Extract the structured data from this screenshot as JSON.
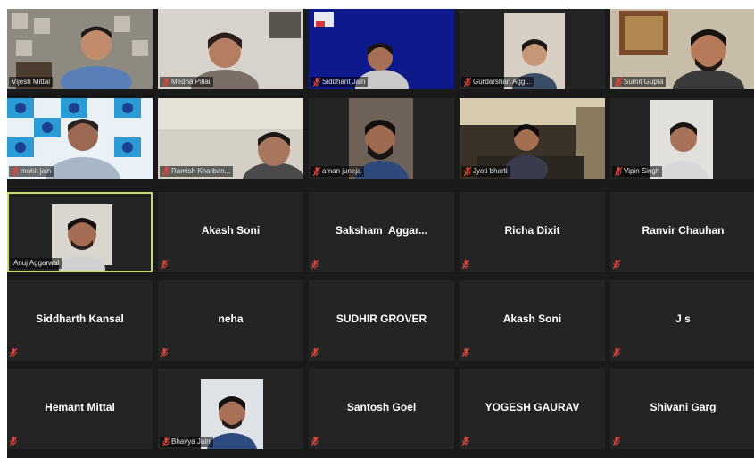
{
  "colors": {
    "background": "#1a1a1a",
    "tile": "#242424",
    "active_border": "#c9dc68",
    "mute_icon": "#e0453a"
  },
  "participants": [
    {
      "name": "Vijesh Mittal",
      "video": true
    },
    {
      "name": "Medha Pillai",
      "video": true
    },
    {
      "name": "Siddhant Jain",
      "video": true
    },
    {
      "name": "Gurdarshan Agg...",
      "video": true
    },
    {
      "name": "Sumit Gupta",
      "video": true
    },
    {
      "name": "mohit jain",
      "video": true
    },
    {
      "name": "Ramish Kharban...",
      "video": true
    },
    {
      "name": "aman juneja",
      "video": true
    },
    {
      "name": "Jyoti bharti",
      "video": true
    },
    {
      "name": "Vipin Singh",
      "video": true
    },
    {
      "name": "Anuj Aggarwal",
      "video": true,
      "active": true
    },
    {
      "name": "Akash Soni",
      "video": false
    },
    {
      "name": "Saksham  Aggar...",
      "video": false
    },
    {
      "name": "Richa Dixit",
      "video": false
    },
    {
      "name": "Ranvir Chauhan",
      "video": false
    },
    {
      "name": "Siddharth Kansal",
      "video": false
    },
    {
      "name": "neha",
      "video": false
    },
    {
      "name": "SUDHIR GROVER",
      "video": false
    },
    {
      "name": "Akash Soni",
      "video": false
    },
    {
      "name": "J s",
      "video": false
    },
    {
      "name": "Hemant Mittal",
      "video": false
    },
    {
      "name": "Bhavya Jain",
      "video": true
    },
    {
      "name": "Santosh Goel",
      "video": false
    },
    {
      "name": "YOGESH GAURAV",
      "video": false
    },
    {
      "name": "Shivani Garg",
      "video": false
    }
  ]
}
